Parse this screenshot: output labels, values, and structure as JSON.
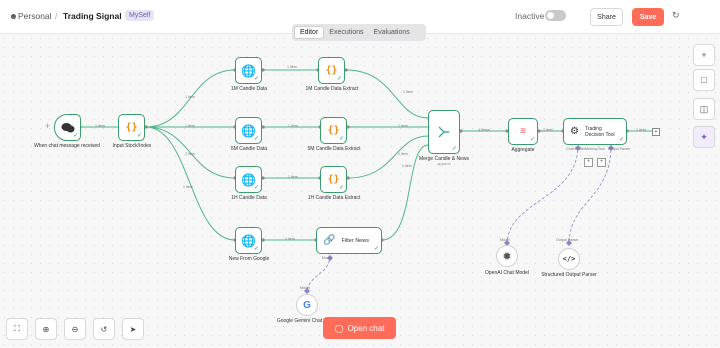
{
  "header": {
    "breadcrumb_root": "Personal",
    "separator": "/",
    "workflow_name": "Trading Signal",
    "tag": "MySelf",
    "inactive_label": "Inactive",
    "share_label": "Share",
    "save_label": "Save"
  },
  "tabs": [
    "Editor",
    "Executions",
    "Evaluations"
  ],
  "nodes": {
    "trigger": "When chat message received",
    "input": "Input Stock/Index",
    "c1m": "1M Candle Data",
    "c1mx": "1M Candle Data Extract",
    "c5m": "5M Candle Data",
    "c5mx": "5M Candle Data Extract",
    "c1h": "1H Candle Data",
    "c1hx": "1H Candle Data Extract",
    "news": "New From Google",
    "filter": "Filter News",
    "merge": "Merge Candle & News",
    "merge_sub": "append",
    "aggregate": "Aggregate",
    "agent": "Trading Decision Tool",
    "openai": "OpenAI Chat Model",
    "parser": "Structured Output Parser",
    "gemini": "Google Gemini Chat Model"
  },
  "edge_labels": {
    "item1": "1 item",
    "items4": "4 items",
    "items5": "5 items"
  },
  "port_labels": {
    "chat_model": "Chat Model",
    "memory": "Memory",
    "tool": "Tool",
    "output_parser": "Output Parser",
    "model": "Model",
    "chat_model_req": "Chat Model*"
  },
  "footer": {
    "open_chat": "Open chat"
  },
  "colors": {
    "accent": "#ff6d5a",
    "edge": "#4fb58a",
    "node_border": "#3a9b6c",
    "ai_edge": "#8a86c9"
  }
}
